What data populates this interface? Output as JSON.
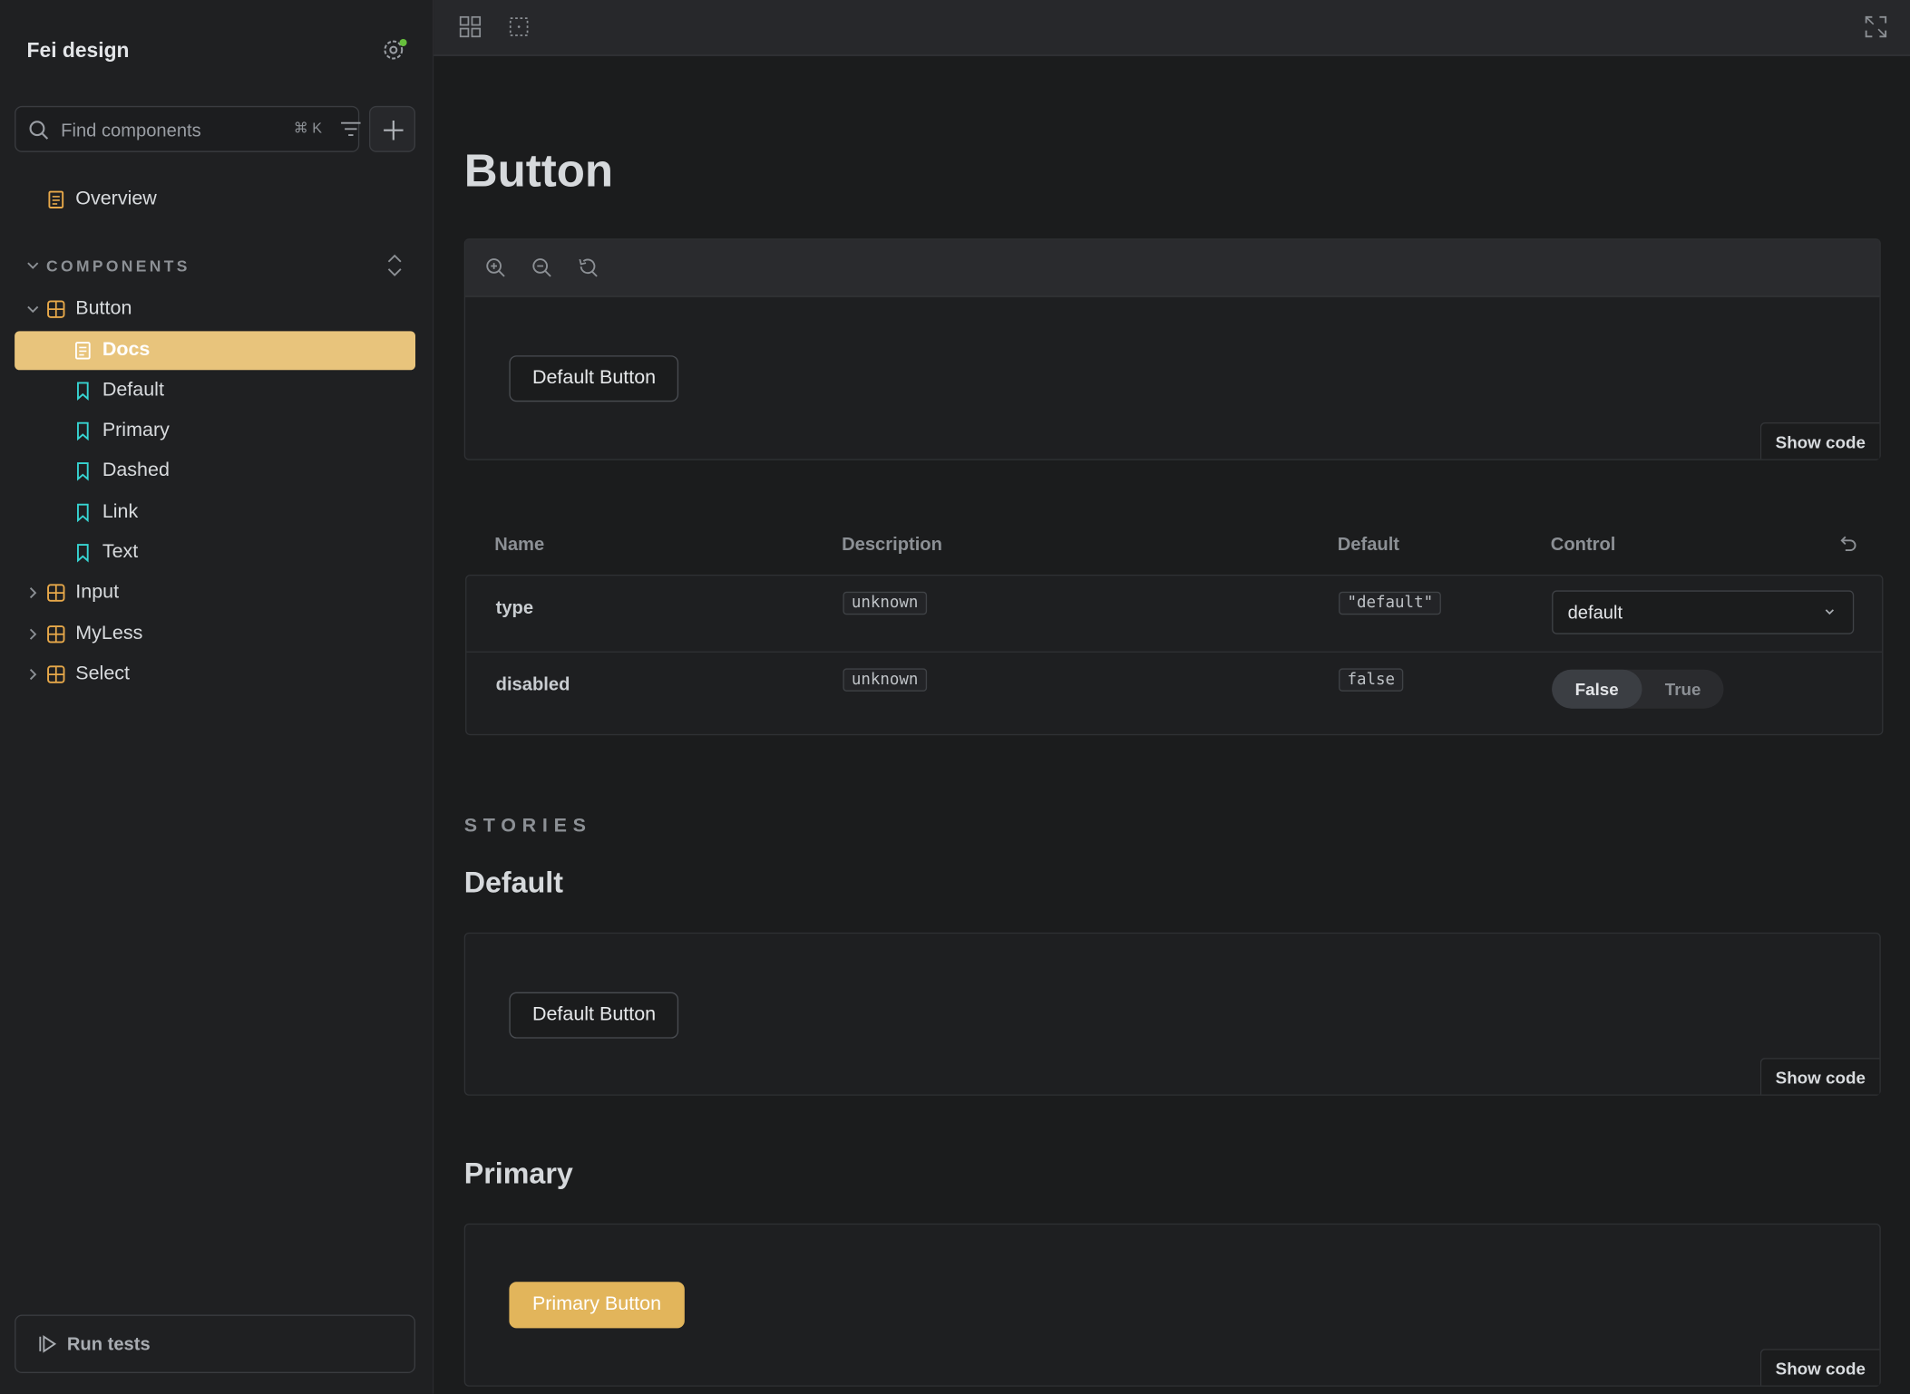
{
  "sidebar": {
    "brand": "Fei design",
    "search": {
      "placeholder": "Find components",
      "shortcut": "⌘ K"
    },
    "overview": "Overview",
    "section_label": "COMPONENTS",
    "tree": {
      "button": "Button",
      "children": [
        "Docs",
        "Default",
        "Primary",
        "Dashed",
        "Link",
        "Text"
      ],
      "collapsed": [
        "Input",
        "MyLess",
        "Select"
      ]
    },
    "run_tests": "Run tests"
  },
  "main": {
    "title": "Button",
    "preview_button": "Default Button",
    "show_code": "Show code",
    "args": {
      "headers": [
        "Name",
        "Description",
        "Default",
        "Control"
      ],
      "rows": [
        {
          "name": "type",
          "description": "unknown",
          "default": "\"default\"",
          "control_value": "default"
        },
        {
          "name": "disabled",
          "description": "unknown",
          "default": "false",
          "toggle": [
            "False",
            "True"
          ]
        }
      ]
    },
    "stories_label": "STORIES",
    "stories": [
      {
        "title": "Default",
        "button": "Default Button"
      },
      {
        "title": "Primary",
        "button": "Primary Button"
      }
    ]
  },
  "colors": {
    "accent": "#e8c47c",
    "primary_button": "#e2b55b",
    "status_dot": "#66bf3c",
    "story_icon": "#37d5d3",
    "doc_icon": "#e8a94a"
  }
}
